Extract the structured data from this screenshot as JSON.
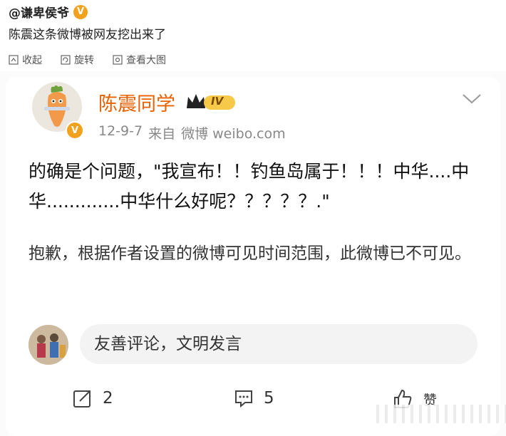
{
  "post": {
    "author": "@谦卑侯爷",
    "verified_badge": "V",
    "text": "陈震这条微博被网友挖出来了",
    "image_tools": [
      {
        "label": "收起",
        "icon": "collapse-icon"
      },
      {
        "label": "旋转",
        "icon": "rotate-icon"
      },
      {
        "label": "查看大图",
        "icon": "view-large-icon"
      }
    ]
  },
  "screenshot": {
    "username": "陈震同学",
    "level_badge": "IV",
    "verified_badge": "V",
    "date": "12-9-7",
    "source_prefix": "来自",
    "source": "微博 weibo.com",
    "body_text": "的确是个问题，\"我宣布！！钓鱼岛属于！！！中华....中华.............中华什么好呢？？？？？.\"",
    "notice": "抱歉，根据作者设置的微博可见时间范围，此微博已不可见。",
    "comment_placeholder": "友善评论，文明发言",
    "repost_count": "2",
    "comment_count": "5",
    "like_label": "赞"
  },
  "colors": {
    "username": "#e86100",
    "badge": "#f2a11d",
    "text": "#111111",
    "meta": "#888888"
  }
}
